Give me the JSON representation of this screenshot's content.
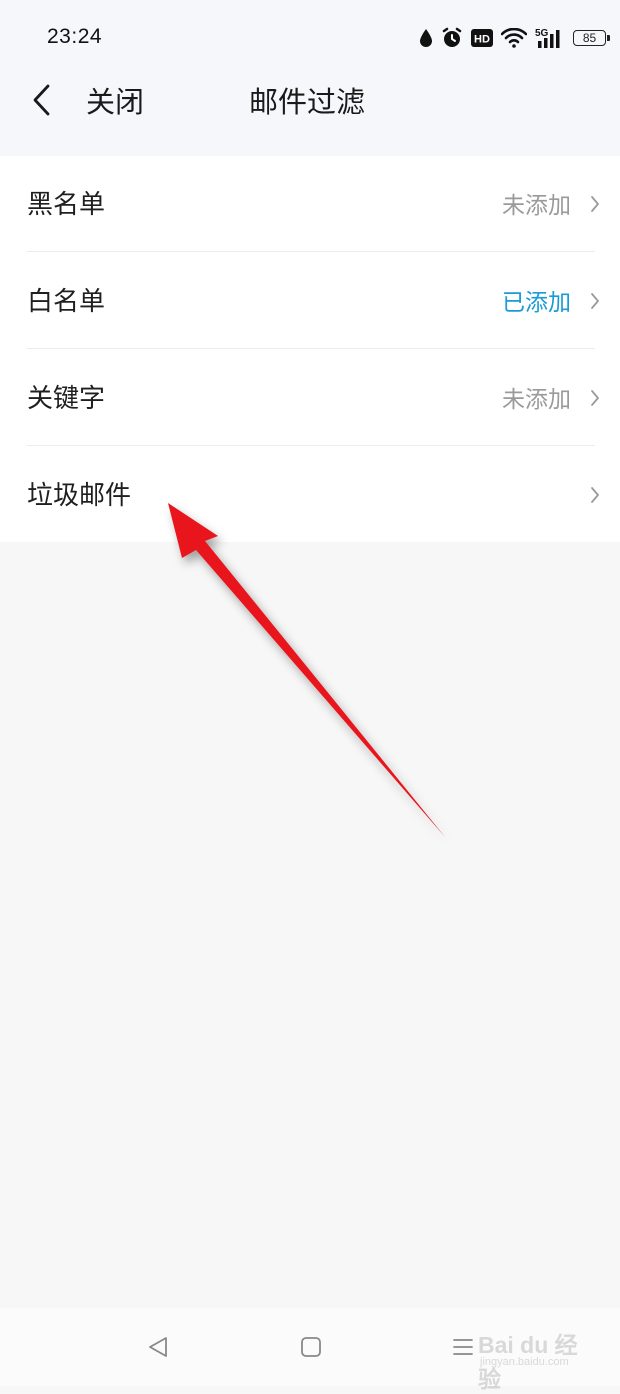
{
  "status_bar": {
    "time": "23:24",
    "icons": [
      "drop-icon",
      "alarm-icon",
      "hd-icon",
      "wifi-icon",
      "5g-signal-icon"
    ],
    "network": "5G",
    "hd_label": "HD",
    "battery": "85"
  },
  "header": {
    "back_icon": "chevron-left-icon",
    "close_label": "关闭",
    "title": "邮件过滤"
  },
  "filters": [
    {
      "label": "黑名单",
      "status": "未添加"
    },
    {
      "label": "白名单",
      "status": "已添加"
    },
    {
      "label": "关键字",
      "status": "未添加"
    },
    {
      "label": "垃圾邮件",
      "status": ""
    }
  ],
  "colors": {
    "added_status": "#1a9bd7",
    "not_added_status": "#9a9a9a",
    "annotation_arrow": "#e8131a"
  },
  "nav_bar": {
    "icons": [
      "triangle-back-icon",
      "square-home-icon",
      "menu-icon"
    ]
  },
  "watermark": {
    "brand": "Bai du 经验",
    "url": "jingyan.baidu.com"
  }
}
